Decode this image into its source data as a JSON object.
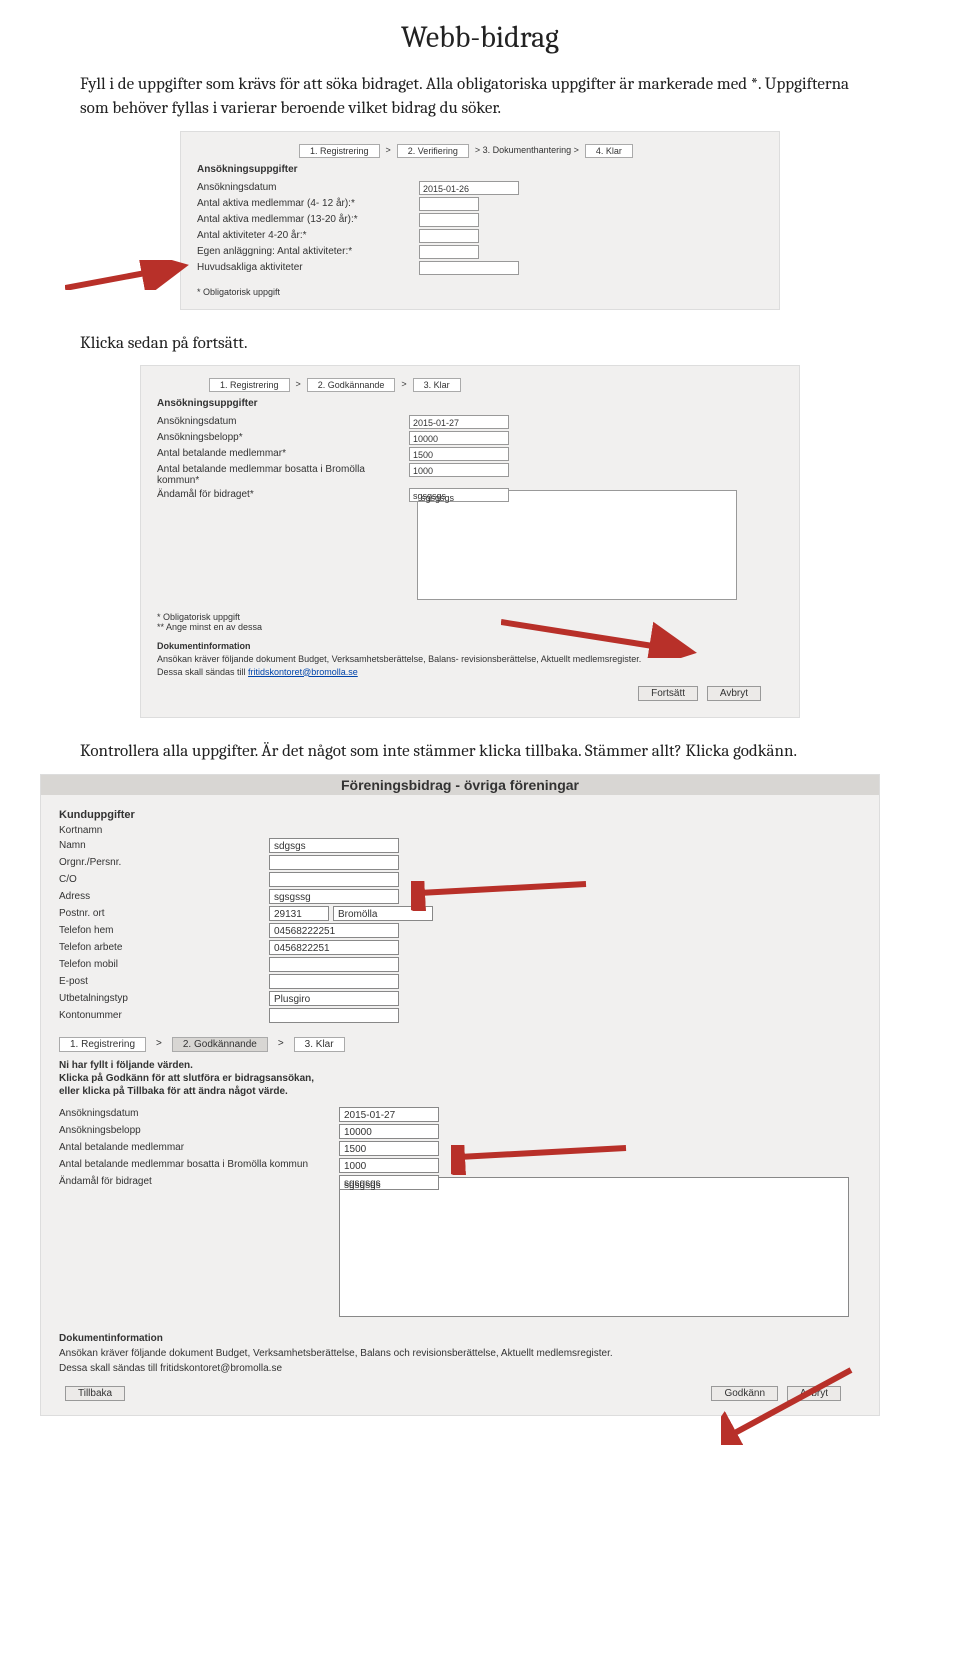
{
  "title": "Webb-bidrag",
  "intro": "Fyll i de uppgifter som krävs för att söka bidraget. Alla obligatoriska uppgifter är markerade med *. Uppgifterna som behöver fyllas i varierar beroende vilket bidrag du söker.",
  "between_1_2": "Klicka sedan på fortsätt.",
  "between_2_3": "Kontrollera alla uppgifter. Är det något som inte stämmer klicka tillbaka. Stämmer allt? Klicka godkänn.",
  "panel1": {
    "steps": [
      "1. Registrering",
      ">",
      "2. Verifiering",
      "> 3. Dokumenthantering >",
      "4. Klar"
    ],
    "heading": "Ansökningsuppgifter",
    "rows": [
      {
        "label": "Ansökningsdatum",
        "value": "2015-01-26"
      },
      {
        "label": "Antal aktiva medlemmar (4- 12 år):*",
        "value": ""
      },
      {
        "label": "Antal aktiva medlemmar (13-20 år):*",
        "value": ""
      },
      {
        "label": "Antal aktiviteter 4-20 år:*",
        "value": ""
      },
      {
        "label": "Egen anläggning: Antal aktiviteter:*",
        "value": ""
      },
      {
        "label": "Huvudsakliga aktiviteter",
        "value": ""
      }
    ],
    "footnote": "* Obligatorisk uppgift"
  },
  "panel2": {
    "steps": [
      "1. Registrering",
      ">",
      "2. Godkännande",
      ">",
      "3. Klar"
    ],
    "heading": "Ansökningsuppgifter",
    "rows": [
      {
        "label": "Ansökningsdatum",
        "value": "2015-01-27"
      },
      {
        "label": "Ansökningsbelopp*",
        "value": "10000"
      },
      {
        "label": "Antal betalande medlemmar*",
        "value": "1500"
      },
      {
        "label": "Antal betalande medlemmar bosatta i Bromölla kommun*",
        "value": "1000"
      },
      {
        "label": "Ändamål för bidraget*",
        "value": "sgsgsgs"
      }
    ],
    "note1": "* Obligatorisk uppgift",
    "note2": "** Ange minst en av dessa",
    "docinfo_hd": "Dokumentinformation",
    "docinfo_line1a": "Ansökan kräver följande dokument Budget, Verksamhetsberättelse, Balans- ",
    "docinfo_line1b": " revisionsberättelse, Aktuellt medlemsregister.",
    "docinfo_line2a": "Dessa skall sändas till ",
    "docinfo_link": "fritidskontoret@bromolla.se",
    "btn_continue": "Fortsätt",
    "btn_cancel": "Avbryt"
  },
  "panel3": {
    "bar_title": "Föreningsbidrag - övriga föreningar",
    "kund_hd": "Kunduppgifter",
    "kund": [
      {
        "label": "Kortnamn",
        "v": ""
      },
      {
        "label": "Namn",
        "v": "sdgsgs"
      },
      {
        "label": "Orgnr./Persnr.",
        "v": ""
      },
      {
        "label": "C/O",
        "v": ""
      },
      {
        "label": "Adress",
        "v": "sgsgssg"
      },
      {
        "label": "Postnr. ort",
        "v": "29131",
        "v2": "Bromölla"
      },
      {
        "label": "Telefon hem",
        "v": "04568222251"
      },
      {
        "label": "Telefon arbete",
        "v": "0456822251"
      },
      {
        "label": "Telefon mobil",
        "v": ""
      },
      {
        "label": "E-post",
        "v": ""
      },
      {
        "label": "Utbetalningstyp",
        "v": "Plusgiro"
      },
      {
        "label": "Kontonummer",
        "v": ""
      }
    ],
    "steps": [
      "1. Registrering",
      ">",
      "2. Godkännande",
      ">",
      "3. Klar"
    ],
    "bold1": "Ni har fyllt i följande värden.",
    "bold2": "Klicka på Godkänn för att slutföra er bidragsansökan,",
    "bold3": "eller klicka på Tillbaka för att ändra något värde.",
    "rows": [
      {
        "label": "Ansökningsdatum",
        "value": "2015-01-27"
      },
      {
        "label": "Ansökningsbelopp",
        "value": "10000"
      },
      {
        "label": "Antal betalande medlemmar",
        "value": "1500"
      },
      {
        "label": "Antal betalande medlemmar bosatta i Bromölla kommun",
        "value": "1000"
      },
      {
        "label": "Ändamål för bidraget",
        "value": "sgsgsgs"
      }
    ],
    "docinfo_hd": "Dokumentinformation",
    "docinfo_line1": "Ansökan kräver följande dokument Budget, Verksamhetsberättelse, Balans och revisionsberättelse, Aktuellt medlemsregister.",
    "docinfo_line2a": "Dessa skall sändas till ",
    "docinfo_link": "fritidskontoret@bromolla.se",
    "btn_back": "Tillbaka",
    "btn_approve": "Godkänn",
    "btn_cancel": "Avbryt"
  }
}
